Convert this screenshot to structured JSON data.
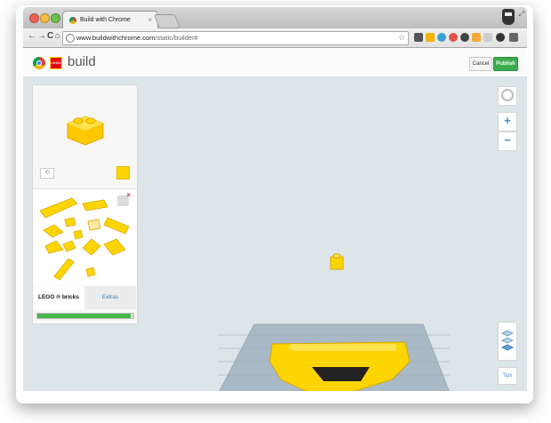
{
  "browser": {
    "tab_title": "Build with Chrome",
    "tab_close": "×",
    "url_host": "www.buildwithchrome.com",
    "url_path": "/static/builder#",
    "back": "←",
    "forward": "→",
    "reload": "C",
    "home": "⌂",
    "bookmark_star": "☆",
    "expand": "⤢"
  },
  "app": {
    "title": "build",
    "lego_logo": "LEGO",
    "cancel_label": "Cancel",
    "publish_label": "Publish"
  },
  "panel": {
    "rotate_symbol": "⟲",
    "tab_bricks": "LEGO ® bricks",
    "tab_extras": "Extras",
    "progress": 0.97,
    "selected_color": "#ffd500"
  },
  "controls": {
    "zoom_in": "+",
    "zoom_out": "−",
    "tips": "Tips"
  },
  "colors": {
    "brick_yellow": "#ffd500",
    "baseplate": "#a8b9c5",
    "accent_green": "#3cab4e"
  }
}
